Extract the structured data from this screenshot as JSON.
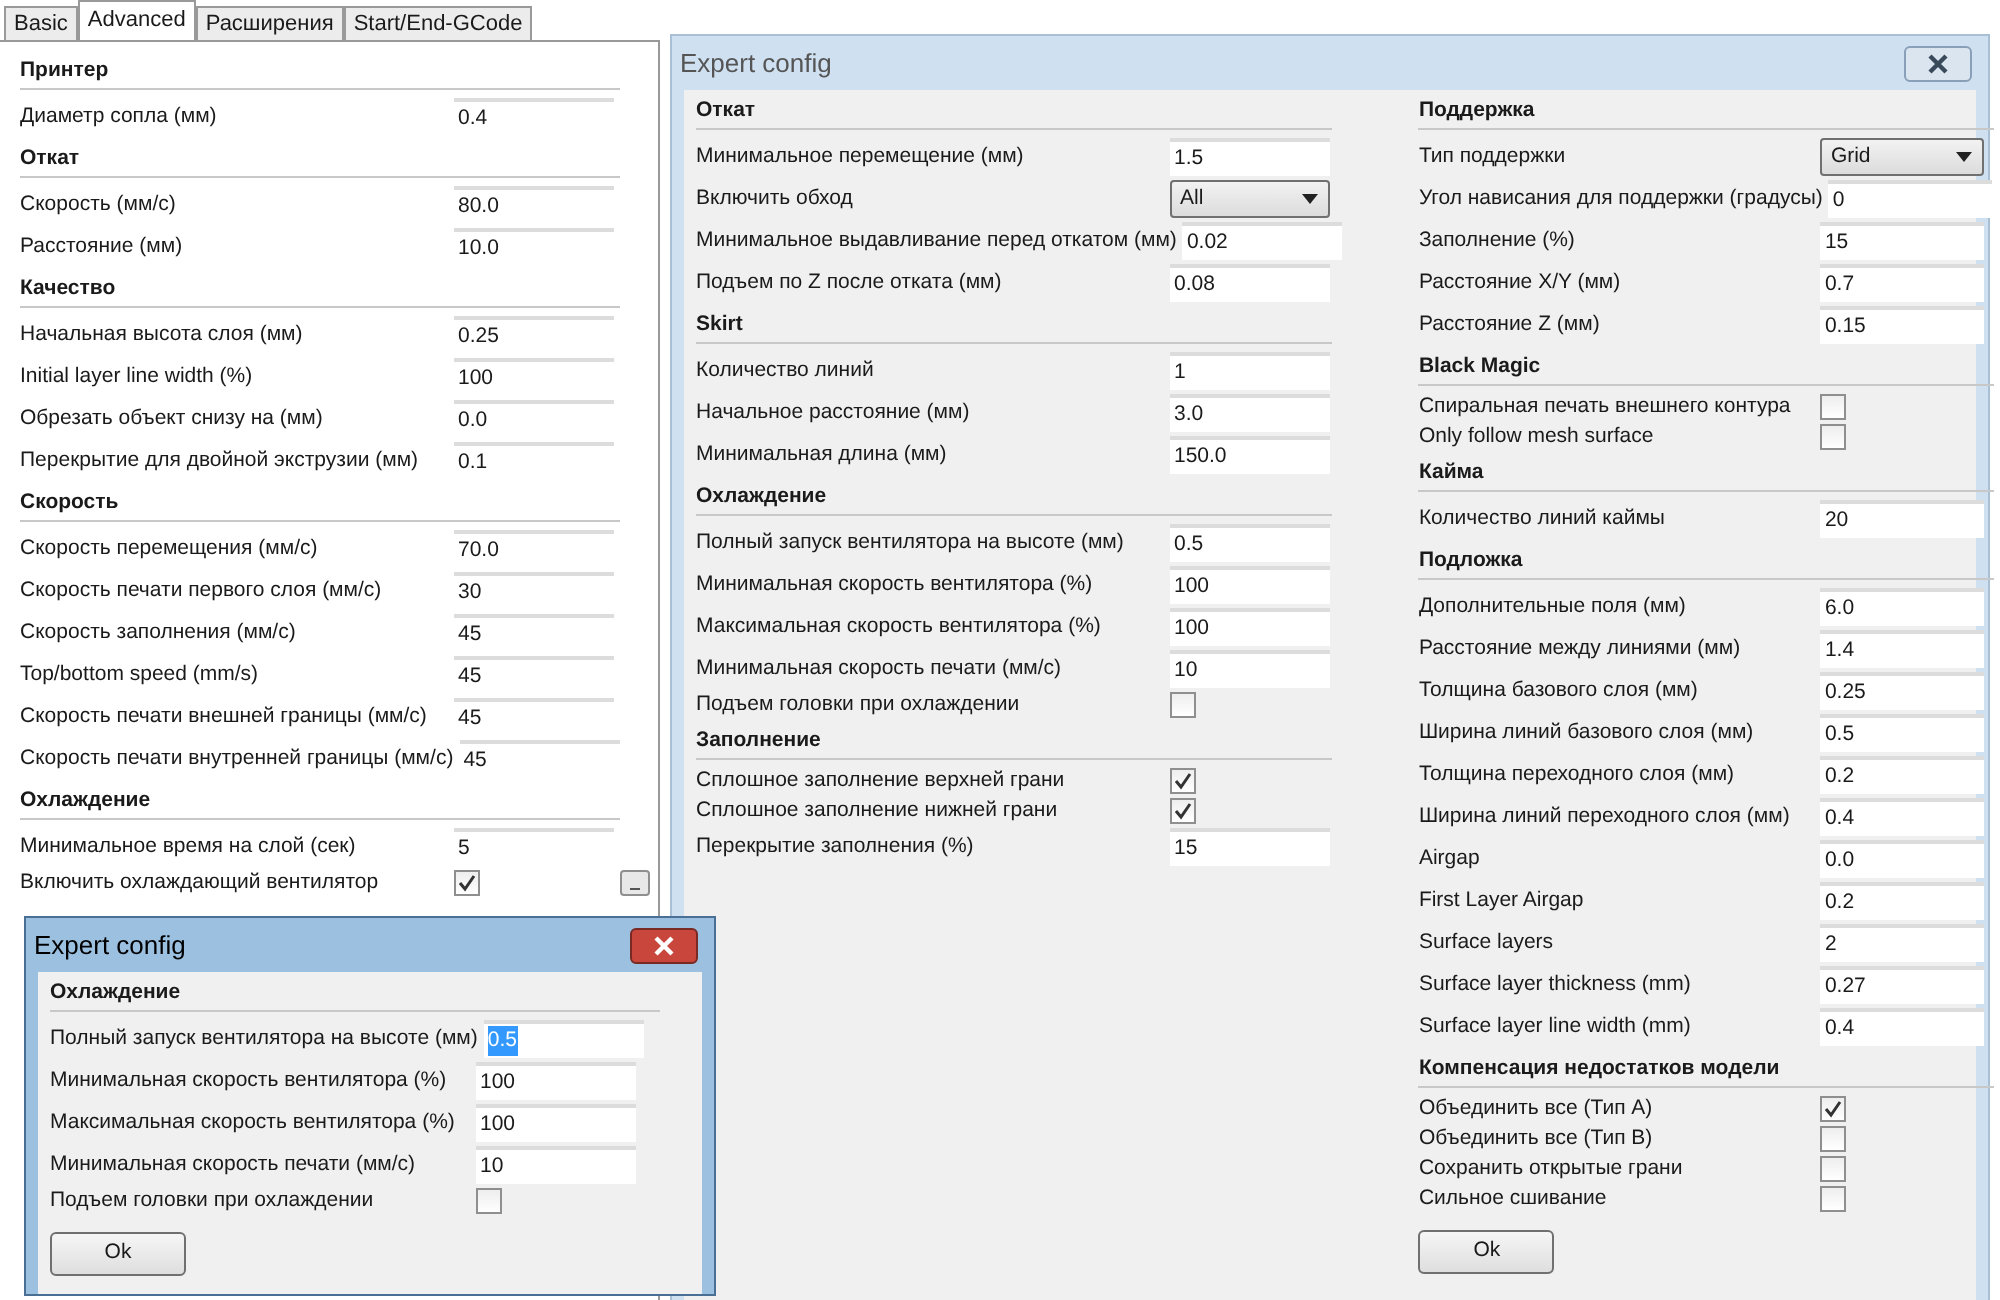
{
  "main_panel": {
    "tabs": [
      {
        "label": "Basic",
        "selected": false
      },
      {
        "label": "Advanced",
        "selected": true
      },
      {
        "label": "Расширения",
        "selected": false
      },
      {
        "label": "Start/End-GCode",
        "selected": false
      }
    ],
    "sections": [
      {
        "title": "Принтер",
        "rows": [
          {
            "kind": "field",
            "label": "Диаметр сопла (мм)",
            "value": "0.4"
          }
        ]
      },
      {
        "title": "Откат",
        "rows": [
          {
            "kind": "field",
            "label": "Скорость (мм/с)",
            "value": "80.0"
          },
          {
            "kind": "field",
            "label": "Расстояние (мм)",
            "value": "10.0"
          }
        ]
      },
      {
        "title": "Качество",
        "rows": [
          {
            "kind": "field",
            "label": "Начальная высота слоя (мм)",
            "value": "0.25"
          },
          {
            "kind": "field",
            "label": "Initial layer line width (%)",
            "value": "100"
          },
          {
            "kind": "field",
            "label": "Обрезать объект снизу на (мм)",
            "value": "0.0"
          },
          {
            "kind": "field",
            "label": "Перекрытие для двойной экструзии (мм)",
            "value": "0.1"
          }
        ]
      },
      {
        "title": "Скорость",
        "rows": [
          {
            "kind": "field",
            "label": "Скорость перемещения (мм/с)",
            "value": "70.0"
          },
          {
            "kind": "field",
            "label": "Скорость печати первого слоя (мм/с)",
            "value": "30"
          },
          {
            "kind": "field",
            "label": "Скорость заполнения (мм/с)",
            "value": "45"
          },
          {
            "kind": "field",
            "label": "Top/bottom speed (mm/s)",
            "value": "45"
          },
          {
            "kind": "field",
            "label": "Скорость печати внешней границы (мм/с)",
            "value": "45"
          },
          {
            "kind": "field",
            "label": "Скорость печати внутренней границы (мм/с)",
            "value": "45"
          }
        ]
      },
      {
        "title": "Охлаждение",
        "rows": [
          {
            "kind": "field",
            "label": "Минимальное время на слой (сек)",
            "value": "5"
          },
          {
            "kind": "checkbox",
            "label": "Включить охлаждающий вентилятор",
            "checked": true,
            "more_button": true
          }
        ]
      }
    ]
  },
  "dialogs": [
    {
      "title": "Expert config",
      "active": true,
      "button": "Ok",
      "columns": [
        [
          {
            "title": "Охлаждение",
            "rows": [
              {
                "kind": "field",
                "label": "Полный запуск вентилятора на высоте (мм)",
                "value": "0.5",
                "text_selected": true
              },
              {
                "kind": "field",
                "label": "Минимальная скорость вентилятора (%)",
                "value": "100"
              },
              {
                "kind": "field",
                "label": "Максимальная скорость вентилятора (%)",
                "value": "100"
              },
              {
                "kind": "field",
                "label": "Минимальная скорость печати (мм/с)",
                "value": "10"
              },
              {
                "kind": "checkbox",
                "label": "Подъем головки при охлаждении",
                "checked": false
              }
            ]
          }
        ]
      ]
    },
    {
      "title": "Expert config",
      "active": false,
      "button": "Ok",
      "columns": [
        [
          {
            "title": "Откат",
            "rows": [
              {
                "kind": "field",
                "label": "Минимальное перемещение (мм)",
                "value": "1.5"
              },
              {
                "kind": "select",
                "label": "Включить обход",
                "value": "All"
              },
              {
                "kind": "field",
                "label": "Минимальное выдавливание перед откатом (мм)",
                "value": "0.02"
              },
              {
                "kind": "field",
                "label": "Подъем по Z после отката (мм)",
                "value": "0.08"
              }
            ]
          },
          {
            "title": "Skirt",
            "rows": [
              {
                "kind": "field",
                "label": "Количество линий",
                "value": "1"
              },
              {
                "kind": "field",
                "label": "Начальное расстояние (мм)",
                "value": "3.0"
              },
              {
                "kind": "field",
                "label": "Минимальная длина (мм)",
                "value": "150.0"
              }
            ]
          },
          {
            "title": "Охлаждение",
            "rows": [
              {
                "kind": "field",
                "label": "Полный запуск вентилятора на высоте (мм)",
                "value": "0.5"
              },
              {
                "kind": "field",
                "label": "Минимальная скорость вентилятора (%)",
                "value": "100"
              },
              {
                "kind": "field",
                "label": "Максимальная скорость вентилятора (%)",
                "value": "100"
              },
              {
                "kind": "field",
                "label": "Минимальная скорость печати (мм/с)",
                "value": "10"
              },
              {
                "kind": "checkbox",
                "label": "Подъем головки при охлаждении",
                "checked": false
              }
            ]
          },
          {
            "title": "Заполнение",
            "rows": [
              {
                "kind": "checkbox",
                "label": "Сплошное заполнение верхней грани",
                "checked": true
              },
              {
                "kind": "checkbox",
                "label": "Сплошное заполнение нижней грани",
                "checked": true
              },
              {
                "kind": "field",
                "label": "Перекрытие заполнения (%)",
                "value": "15"
              }
            ]
          }
        ],
        [
          {
            "title": "Поддержка",
            "rows": [
              {
                "kind": "select",
                "label": "Тип поддержки",
                "value": "Grid"
              },
              {
                "kind": "field",
                "label": "Угол нависания для поддержки (градусы)",
                "value": "0"
              },
              {
                "kind": "field",
                "label": "Заполнение (%)",
                "value": "15"
              },
              {
                "kind": "field",
                "label": "Расстояние X/Y (мм)",
                "value": "0.7"
              },
              {
                "kind": "field",
                "label": "Расстояние Z (мм)",
                "value": "0.15"
              }
            ]
          },
          {
            "title": "Black Magic",
            "rows": [
              {
                "kind": "checkbox",
                "label": "Спиральная печать внешнего контура",
                "checked": false
              },
              {
                "kind": "checkbox",
                "label": "Only follow mesh surface",
                "checked": false
              }
            ]
          },
          {
            "title": "Кайма",
            "rows": [
              {
                "kind": "field",
                "label": "Количество линий каймы",
                "value": "20"
              }
            ]
          },
          {
            "title": "Подложка",
            "rows": [
              {
                "kind": "field",
                "label": "Дополнительные поля (мм)",
                "value": "6.0"
              },
              {
                "kind": "field",
                "label": "Расстояние между линиями (мм)",
                "value": "1.4"
              },
              {
                "kind": "field",
                "label": "Толщина базового слоя (мм)",
                "value": "0.25"
              },
              {
                "kind": "field",
                "label": "Ширина линий базового слоя (мм)",
                "value": "0.5"
              },
              {
                "kind": "field",
                "label": "Толщина переходного слоя (мм)",
                "value": "0.2"
              },
              {
                "kind": "field",
                "label": "Ширина линий переходного слоя (мм)",
                "value": "0.4"
              },
              {
                "kind": "field",
                "label": "Airgap",
                "value": "0.0"
              },
              {
                "kind": "field",
                "label": "First Layer Airgap",
                "value": "0.2"
              },
              {
                "kind": "field",
                "label": "Surface layers",
                "value": "2"
              },
              {
                "kind": "field",
                "label": "Surface layer thickness (mm)",
                "value": "0.27"
              },
              {
                "kind": "field",
                "label": "Surface layer line width (mm)",
                "value": "0.4"
              }
            ]
          },
          {
            "title": "Компенсация недостатков модели",
            "rows": [
              {
                "kind": "checkbox",
                "label": "Объединить все (Тип A)",
                "checked": true
              },
              {
                "kind": "checkbox",
                "label": "Объединить все (Тип B)",
                "checked": false
              },
              {
                "kind": "checkbox",
                "label": "Сохранить открытые грани",
                "checked": false
              },
              {
                "kind": "checkbox",
                "label": "Сильное сшивание",
                "checked": false
              }
            ]
          }
        ]
      ]
    }
  ]
}
